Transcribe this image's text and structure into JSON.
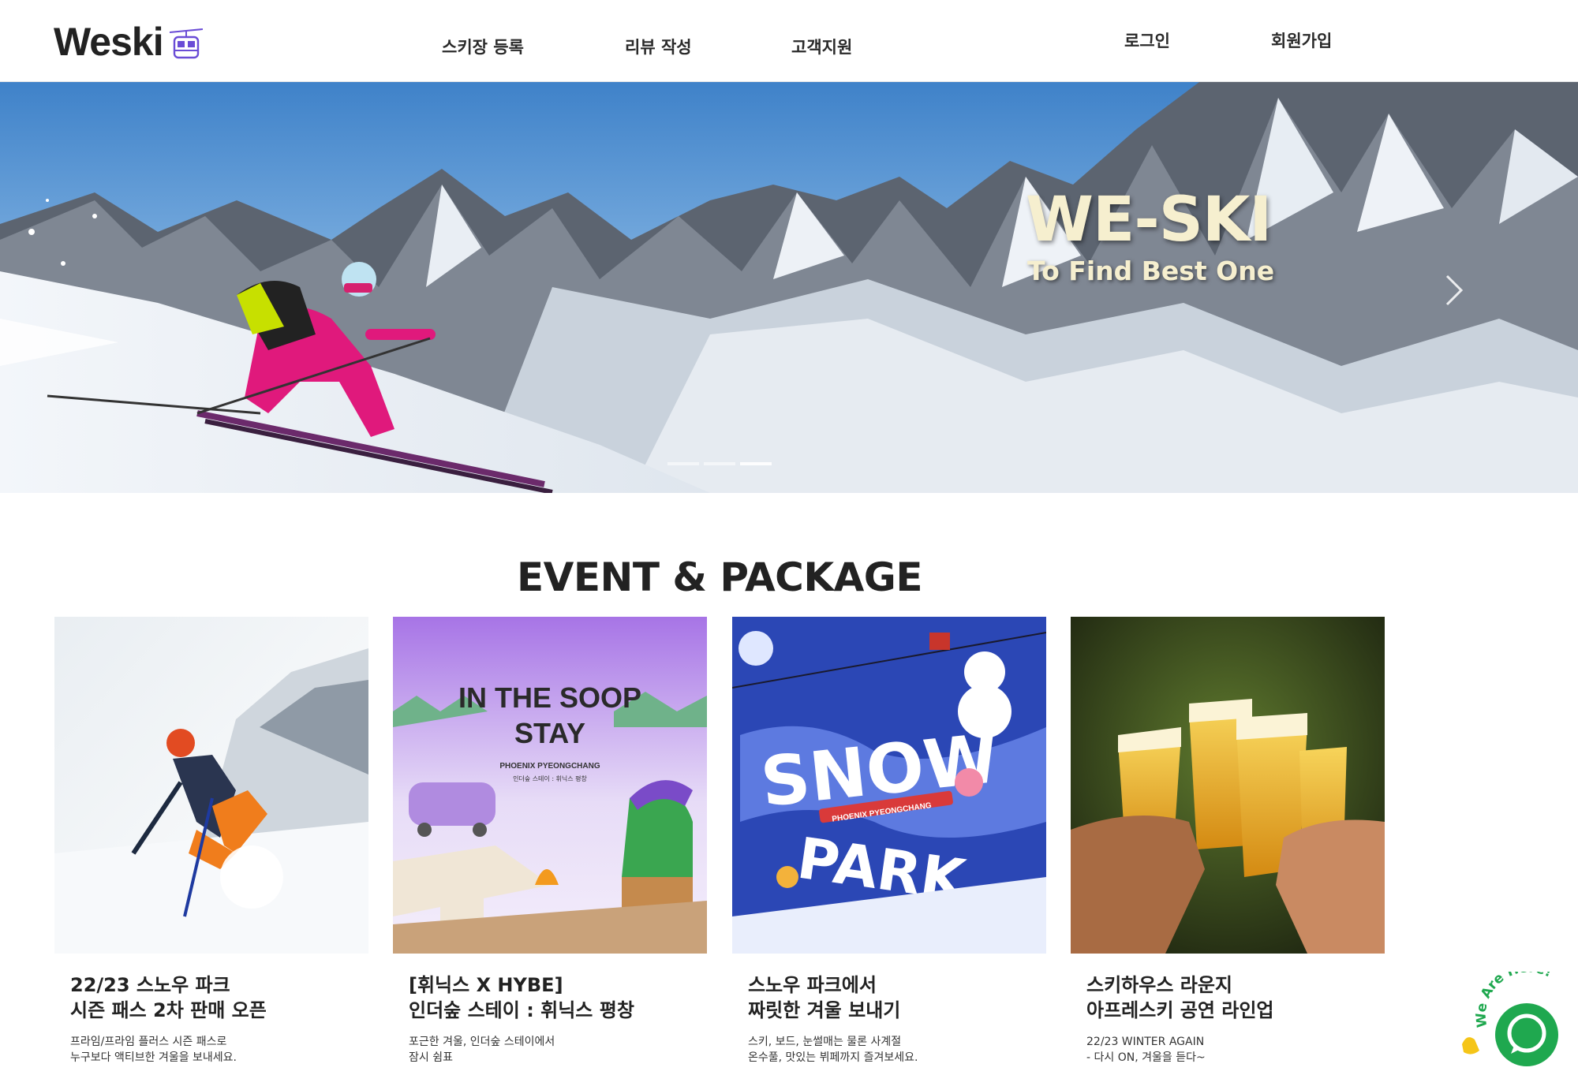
{
  "brand": {
    "name": "Weski",
    "logo_icon": "gondola-icon",
    "accent_color": "#6a4cd6"
  },
  "nav": {
    "items": [
      "스키장 등록",
      "리뷰 작성",
      "고객지원"
    ],
    "login": "로그인",
    "signup": "회원가입"
  },
  "hero": {
    "title": "WE-SKI",
    "subtitle": "To Find Best One",
    "next_icon": "chevron-right-icon",
    "slide_count": 3,
    "active_slide": 3
  },
  "events": {
    "title": "EVENT & PACKAGE",
    "cards": [
      {
        "title_line1": "22/23 스노우 파크",
        "title_line2": "시즌 패스 2차 판매 오픈",
        "desc_line1": "프라임/프라임 플러스 시즌 패스로",
        "desc_line2": "누구보다 액티브한 겨울을 보내세요."
      },
      {
        "title_line1": "[휘닉스 X HYBE]",
        "title_line2": "인더숲 스테이 : 휘닉스 평창",
        "desc_line1": "포근한 겨울, 인더숲 스테이에서",
        "desc_line2": "잠시 쉼표",
        "image_text_1": "IN THE SOOP",
        "image_text_2": "STAY",
        "image_text_3": "PHOENIX PYEONGCHANG",
        "image_text_4": "인더숲 스테이 : 휘닉스 평창"
      },
      {
        "title_line1": "스노우 파크에서",
        "title_line2": "짜릿한 겨울 보내기",
        "desc_line1": "스키, 보드, 눈썰매는 물론 사계절",
        "desc_line2": "온수풀, 맛있는 뷔페까지 즐겨보세요.",
        "image_text_1": "SNOW",
        "image_text_2": "PARK",
        "image_text_3": "PHOENIX PYEONGCHANG"
      },
      {
        "title_line1": "스키하우스 라운지",
        "title_line2": "아프레스키 공연 라인업",
        "desc_line1": "22/23 WINTER AGAIN",
        "desc_line2": "- 다시 ON, 겨울을 듣다~"
      }
    ]
  },
  "chat": {
    "label": "We Are Here!",
    "icon": "chat-bubble-icon",
    "color": "#1fa84f"
  }
}
